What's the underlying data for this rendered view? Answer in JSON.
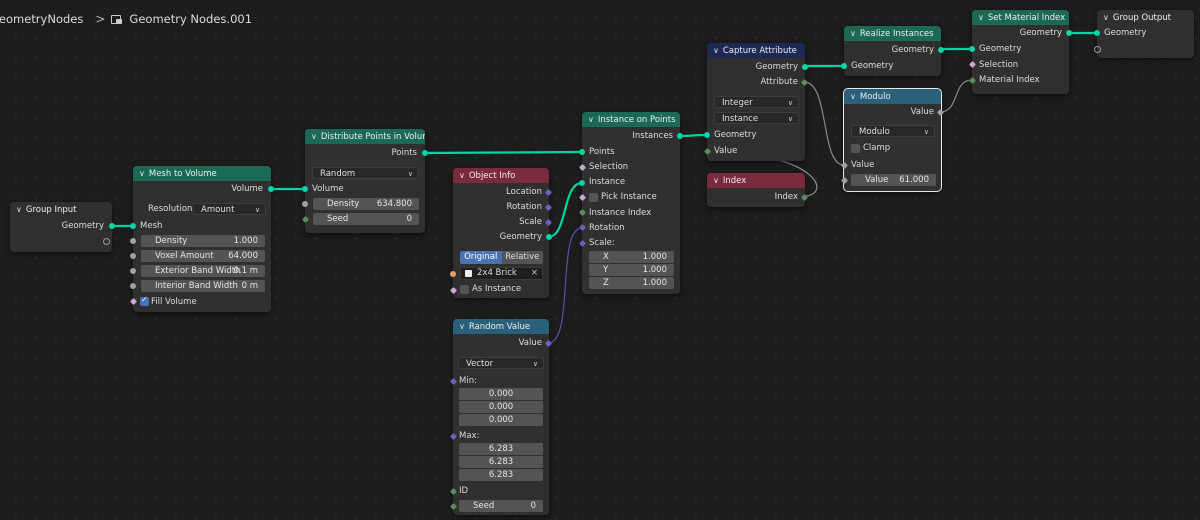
{
  "breadcrumb": {
    "tree": "GeometryNodes",
    "separator": ">",
    "group": "Geometry Nodes.001"
  },
  "colors": {
    "geometry_socket": "#00d6a3",
    "vector_socket": "#6363c7",
    "integer_socket": "#598c5c",
    "boolean_socket": "#cca6d6",
    "float_socket": "#a1a1a1",
    "object_socket": "#ed9e5c",
    "geometry_header": "#1b6a58",
    "attribute_header": "#1d2a55",
    "converter_header": "#29607a",
    "input_header": "#7c2a3d",
    "toggle_on": "#4772b3"
  },
  "nodes": {
    "group_input": {
      "title": "Group Input",
      "geometry": "Geometry"
    },
    "mesh_to_volume": {
      "title": "Mesh to Volume",
      "out_volume": "Volume",
      "resolution_label": "Resolution",
      "resolution_value": "Amount",
      "in_mesh": "Mesh",
      "density_label": "Density",
      "density_value": "1.000",
      "voxel_label": "Voxel Amount",
      "voxel_value": "64.000",
      "ext_label": "Exterior Band Width",
      "ext_value": "0.1 m",
      "int_label": "Interior Band Width",
      "int_value": "0 m",
      "fill_label": "Fill Volume"
    },
    "distribute": {
      "title": "Distribute Points in Volume",
      "out_points": "Points",
      "mode": "Random",
      "in_volume": "Volume",
      "density_label": "Density",
      "density_value": "634.800",
      "seed_label": "Seed",
      "seed_value": "0"
    },
    "object_info": {
      "title": "Object Info",
      "location": "Location",
      "rotation": "Rotation",
      "scale": "Scale",
      "geometry": "Geometry",
      "original": "Original",
      "relative": "Relative",
      "object": "2x4 Brick",
      "as_instance": "As Instance",
      "clear": "×"
    },
    "random_value": {
      "title": "Random Value",
      "out_value": "Value",
      "type": "Vector",
      "min_label": "Min:",
      "min": [
        "0.000",
        "0.000",
        "0.000"
      ],
      "max_label": "Max:",
      "max": [
        "6.283",
        "6.283",
        "6.283"
      ],
      "id_label": "ID",
      "seed_label": "Seed",
      "seed_value": "0"
    },
    "instance_on_points": {
      "title": "Instance on Points",
      "out_instances": "Instances",
      "points": "Points",
      "selection": "Selection",
      "instance": "Instance",
      "pick_instance": "Pick Instance",
      "instance_index": "Instance Index",
      "rotation": "Rotation",
      "scale": "Scale:",
      "sx_label": "X",
      "sx": "1.000",
      "sy_label": "Y",
      "sy": "1.000",
      "sz_label": "Z",
      "sz": "1.000"
    },
    "capture": {
      "title": "Capture Attribute",
      "out_geometry": "Geometry",
      "out_attribute": "Attribute",
      "data_type": "Integer",
      "domain": "Instance",
      "in_geometry": "Geometry",
      "in_value": "Value"
    },
    "index": {
      "title": "Index",
      "out_index": "Index"
    },
    "realize": {
      "title": "Realize Instances",
      "out_geometry": "Geometry",
      "in_geometry": "Geometry"
    },
    "modulo": {
      "title": "Modulo",
      "out_value": "Value",
      "operation": "Modulo",
      "clamp": "Clamp",
      "in_value": "Value",
      "value_label": "Value",
      "value": "61.000"
    },
    "set_material_index": {
      "title": "Set Material Index",
      "out_geometry": "Geometry",
      "in_geometry": "Geometry",
      "selection": "Selection",
      "material_index": "Material Index"
    },
    "group_output": {
      "title": "Group Output",
      "geometry": "Geometry"
    }
  }
}
